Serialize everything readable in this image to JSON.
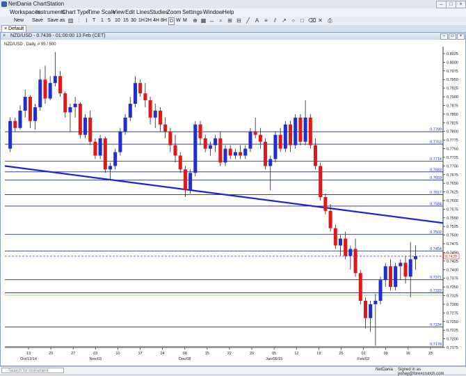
{
  "app": {
    "title": "NetDania ChartStation"
  },
  "menu": [
    "Workspaces",
    "Instruments",
    "Chart Type",
    "Time Scale",
    "View",
    "Edit",
    "Lines",
    "Studies",
    "Zoom",
    "Settings",
    "Window",
    "Help"
  ],
  "toolbar": {
    "new_label": "New",
    "save_label": "Save",
    "saveas_label": "Save as",
    "time_buttons": [
      "T",
      "1",
      "5",
      "10",
      "15",
      "30",
      "1H",
      "2H",
      "4H",
      "8H",
      "D",
      "W",
      "M"
    ],
    "selected_time": "D"
  },
  "tab": {
    "label": "Default"
  },
  "window": {
    "title": "NZD/USD - 0.7439 - 01:00:00 13 Feb (CET)"
  },
  "chart_data": {
    "type": "candlestick",
    "instrument": "NZD/USD",
    "subtitle": "NZD/USD , Daily, # 95 / 500",
    "ylim": [
      0.7175,
      0.8025
    ],
    "y_ticks": [
      "0.8025",
      "0.8000",
      "0.7975",
      "0.7950",
      "0.7925",
      "0.7900",
      "0.7875",
      "0.7850",
      "0.7825",
      "0.7800",
      "0.7775",
      "0.7750",
      "0.7725",
      "0.7700",
      "0.7675",
      "0.7650",
      "0.7625",
      "0.7600",
      "0.7575",
      "0.7550",
      "0.7525",
      "0.7500",
      "0.7475",
      "0.7450",
      "0.7425",
      "0.7400",
      "0.7375",
      "0.7350",
      "0.7325",
      "0.7300",
      "0.7275",
      "0.7250",
      "0.7225",
      "0.7200",
      "0.7175"
    ],
    "x_ticks": [
      "13",
      "20",
      "27",
      "03",
      "10",
      "17",
      "24",
      "08",
      "15",
      "22",
      "29",
      "05",
      "12",
      "19",
      "26",
      "02",
      "09",
      "16",
      "23"
    ],
    "x_sublabels": [
      "Oct/13/14",
      "Nov/03",
      "Dec/08",
      "Jan/05/15",
      "Feb/02"
    ],
    "horizontal_levels": [
      {
        "value": 0.7799,
        "label": "0.7799",
        "color": "#1a237e"
      },
      {
        "value": 0.7763,
        "label": "0.7763",
        "color": "#1a237e"
      },
      {
        "value": 0.7714,
        "label": "0.7714",
        "color": "#1a237e"
      },
      {
        "value": 0.7683,
        "label": "0.7683",
        "color": "#1a237e"
      },
      {
        "value": 0.7659,
        "label": "0.7659",
        "color": "#1a237e"
      },
      {
        "value": 0.7617,
        "label": "0.7617",
        "color": "#1a237e"
      },
      {
        "value": 0.7584,
        "label": "0.7584",
        "color": "#1a237e"
      },
      {
        "value": 0.7502,
        "label": "0.7502",
        "color": "#1a237e"
      },
      {
        "value": 0.7454,
        "label": "0.7454",
        "color": "#1a237e"
      },
      {
        "value": 0.7371,
        "label": "0.7371",
        "color": "#1a237e"
      },
      {
        "value": 0.7333,
        "label": "0.7333",
        "color": "#1a237e"
      },
      {
        "value": 0.7234,
        "label": "0.7234",
        "color": "#1a237e"
      },
      {
        "value": 0.7178,
        "label": "0.7178",
        "color": "#1a237e"
      }
    ],
    "last_price": {
      "value": 0.7439,
      "label": "0.7439",
      "color": "#c62828"
    },
    "trendline": {
      "start_value": 0.77,
      "end_value": 0.7535,
      "color": "#1f23d6"
    },
    "colors": {
      "up": "#1f2fd0",
      "down": "#e01818"
    },
    "candles": [
      [
        0.775,
        0.784,
        0.774,
        0.783
      ],
      [
        0.783,
        0.784,
        0.78,
        0.781
      ],
      [
        0.781,
        0.7875,
        0.7805,
        0.786
      ],
      [
        0.786,
        0.792,
        0.784,
        0.79
      ],
      [
        0.79,
        0.7905,
        0.781,
        0.783
      ],
      [
        0.783,
        0.788,
        0.7805,
        0.787
      ],
      [
        0.787,
        0.798,
        0.786,
        0.795
      ],
      [
        0.795,
        0.799,
        0.788,
        0.7895
      ],
      [
        0.7895,
        0.796,
        0.789,
        0.794
      ],
      [
        0.794,
        0.803,
        0.793,
        0.796
      ],
      [
        0.796,
        0.7975,
        0.79,
        0.791
      ],
      [
        0.791,
        0.7915,
        0.784,
        0.7855
      ],
      [
        0.7855,
        0.788,
        0.78,
        0.787
      ],
      [
        0.787,
        0.79,
        0.784,
        0.788
      ],
      [
        0.788,
        0.7885,
        0.778,
        0.779
      ],
      [
        0.779,
        0.785,
        0.778,
        0.784
      ],
      [
        0.784,
        0.786,
        0.776,
        0.777
      ],
      [
        0.777,
        0.778,
        0.772,
        0.773
      ],
      [
        0.773,
        0.779,
        0.772,
        0.778
      ],
      [
        0.778,
        0.7785,
        0.768,
        0.769
      ],
      [
        0.769,
        0.771,
        0.766,
        0.77
      ],
      [
        0.77,
        0.775,
        0.769,
        0.774
      ],
      [
        0.774,
        0.781,
        0.773,
        0.78
      ],
      [
        0.78,
        0.785,
        0.779,
        0.784
      ],
      [
        0.784,
        0.79,
        0.783,
        0.788
      ],
      [
        0.788,
        0.796,
        0.787,
        0.794
      ],
      [
        0.794,
        0.795,
        0.79,
        0.791
      ],
      [
        0.791,
        0.794,
        0.787,
        0.789
      ],
      [
        0.789,
        0.79,
        0.782,
        0.784
      ],
      [
        0.784,
        0.788,
        0.781,
        0.786
      ],
      [
        0.786,
        0.787,
        0.78,
        0.782
      ],
      [
        0.782,
        0.784,
        0.778,
        0.78
      ],
      [
        0.78,
        0.781,
        0.774,
        0.776
      ],
      [
        0.776,
        0.779,
        0.771,
        0.773
      ],
      [
        0.773,
        0.774,
        0.768,
        0.769
      ],
      [
        0.769,
        0.77,
        0.761,
        0.763
      ],
      [
        0.763,
        0.769,
        0.762,
        0.768
      ],
      [
        0.768,
        0.783,
        0.767,
        0.782
      ],
      [
        0.782,
        0.783,
        0.776,
        0.778
      ],
      [
        0.778,
        0.779,
        0.774,
        0.775
      ],
      [
        0.775,
        0.777,
        0.773,
        0.776
      ],
      [
        0.776,
        0.779,
        0.774,
        0.778
      ],
      [
        0.778,
        0.78,
        0.77,
        0.771
      ],
      [
        0.771,
        0.776,
        0.77,
        0.775
      ],
      [
        0.775,
        0.776,
        0.772,
        0.773
      ],
      [
        0.773,
        0.775,
        0.772,
        0.774
      ],
      [
        0.774,
        0.776,
        0.772,
        0.773
      ],
      [
        0.773,
        0.776,
        0.772,
        0.775
      ],
      [
        0.775,
        0.781,
        0.774,
        0.78
      ],
      [
        0.78,
        0.784,
        0.778,
        0.779
      ],
      [
        0.779,
        0.781,
        0.775,
        0.777
      ],
      [
        0.777,
        0.778,
        0.769,
        0.77
      ],
      [
        0.77,
        0.773,
        0.763,
        0.772
      ],
      [
        0.772,
        0.78,
        0.771,
        0.779
      ],
      [
        0.779,
        0.781,
        0.774,
        0.775
      ],
      [
        0.775,
        0.783,
        0.774,
        0.782
      ],
      [
        0.782,
        0.783,
        0.774,
        0.776
      ],
      [
        0.776,
        0.785,
        0.775,
        0.784
      ],
      [
        0.784,
        0.785,
        0.776,
        0.777
      ],
      [
        0.777,
        0.789,
        0.776,
        0.784
      ],
      [
        0.784,
        0.785,
        0.775,
        0.776
      ],
      [
        0.776,
        0.778,
        0.769,
        0.77
      ],
      [
        0.77,
        0.771,
        0.76,
        0.761
      ],
      [
        0.761,
        0.762,
        0.756,
        0.757
      ],
      [
        0.757,
        0.759,
        0.751,
        0.752
      ],
      [
        0.752,
        0.753,
        0.746,
        0.747
      ],
      [
        0.747,
        0.75,
        0.744,
        0.749
      ],
      [
        0.749,
        0.751,
        0.743,
        0.744
      ],
      [
        0.744,
        0.747,
        0.74,
        0.746
      ],
      [
        0.746,
        0.749,
        0.738,
        0.739
      ],
      [
        0.739,
        0.74,
        0.73,
        0.731
      ],
      [
        0.731,
        0.732,
        0.723,
        0.726
      ],
      [
        0.726,
        0.731,
        0.722,
        0.73
      ],
      [
        0.73,
        0.733,
        0.718,
        0.731
      ],
      [
        0.731,
        0.738,
        0.73,
        0.737
      ],
      [
        0.737,
        0.742,
        0.735,
        0.741
      ],
      [
        0.741,
        0.743,
        0.734,
        0.735
      ],
      [
        0.735,
        0.742,
        0.734,
        0.741
      ],
      [
        0.741,
        0.743,
        0.737,
        0.742
      ],
      [
        0.742,
        0.744,
        0.736,
        0.738
      ],
      [
        0.738,
        0.748,
        0.732,
        0.743
      ],
      [
        0.743,
        0.747,
        0.74,
        0.7439
      ]
    ]
  },
  "status": {
    "search_placeholder": "Search for instrument",
    "brand": "NetDania",
    "signed_in": "Signed in as yohay@forexcrunch.com"
  }
}
